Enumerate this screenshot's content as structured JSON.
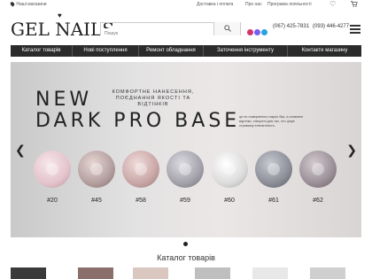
{
  "topbar": {
    "store_label": "Наші магазини",
    "links": [
      "Доставка і оплата",
      "Про нас",
      "Програма лояльності"
    ]
  },
  "header": {
    "logo_text": "GEL NAILS",
    "search_placeholder": "Пошук",
    "phones": [
      "(067) 425-7831",
      "(093) 446-4277"
    ]
  },
  "nav": {
    "items": [
      "Каталог товарів",
      "Нові поступлення",
      "Ремонт обладнання",
      "Заточення інструменту",
      "Контакти магазину"
    ]
  },
  "banner": {
    "headline1": "NEW",
    "headline2": "DARK PRO BASE",
    "subtitle": "КОМФОРТНЕ НАНЕСЕННЯ, ПОЄДНАННЯ ЯКОСТІ ТА ВІДТІНКІВ",
    "description": "це не повернення старих баз, а оновлені відтінки, створені для тих, хто цінує стриману елегантність.",
    "shades": [
      "#20",
      "#45",
      "#58",
      "#59",
      "#60",
      "#61",
      "#62"
    ],
    "shade_colors": [
      "#e4c4cc",
      "#b49f9f",
      "#c9a6a6",
      "#a3a1aa",
      "#dcdcdc",
      "#8c8e98",
      "#9a8f96"
    ]
  },
  "catalog": {
    "title": "Каталог товарів"
  },
  "colors": {
    "nav_bg": "#2b2b2b",
    "instagram": "#d6336c",
    "viber": "#7360f2",
    "telegram": "#2aa3e0"
  }
}
